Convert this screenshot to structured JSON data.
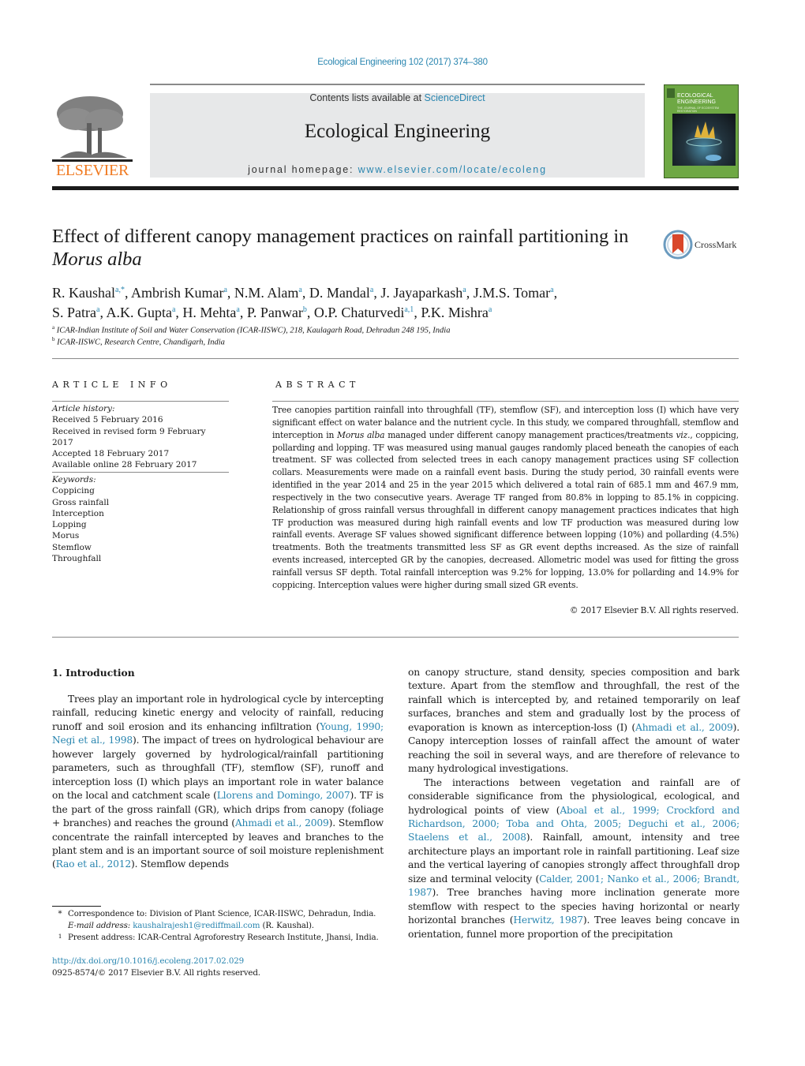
{
  "header": {
    "citation": "Ecological Engineering 102 (2017) 374–380",
    "publisher_logo_text": "ELSEVIER",
    "contents_prefix": "Contents lists available at ",
    "contents_link": "ScienceDirect",
    "journal_title": "Ecological Engineering",
    "homepage_prefix": "journal homepage: ",
    "homepage_link": "www.elsevier.com/locate/ecoleng",
    "cover_title": "ECOLOGICAL ENGINEERING",
    "cover_subtitle": "THE JOURNAL OF ECOSYSTEM RESTORATION"
  },
  "article": {
    "title_main": "Effect of different canopy management practices on rainfall partitioning in ",
    "title_italic": "Morus alba",
    "crossmark_label": "CrossMark",
    "authors": [
      {
        "name": "R. Kaushal",
        "sup": "a,*"
      },
      {
        "name": "Ambrish Kumar",
        "sup": "a"
      },
      {
        "name": "N.M. Alam",
        "sup": "a"
      },
      {
        "name": "D. Mandal",
        "sup": "a"
      },
      {
        "name": "J. Jayaparkash",
        "sup": "a"
      },
      {
        "name": "J.M.S. Tomar",
        "sup": "a"
      },
      {
        "name": "S. Patra",
        "sup": "a"
      },
      {
        "name": "A.K. Gupta",
        "sup": "a"
      },
      {
        "name": "H. Mehta",
        "sup": "a"
      },
      {
        "name": "P. Panwar",
        "sup": "b"
      },
      {
        "name": "O.P. Chaturvedi",
        "sup": "a,1"
      },
      {
        "name": "P.K. Mishra",
        "sup": "a"
      }
    ],
    "affiliations": [
      {
        "mark": "a",
        "text": "ICAR-Indian Institute of Soil and Water Conservation (ICAR-IISWC), 218, Kaulagarh Road, Dehradun 248 195, India"
      },
      {
        "mark": "b",
        "text": "ICAR-IISWC, Research Centre, Chandigarh, India"
      }
    ]
  },
  "article_info": {
    "heading": "ARTICLE INFO",
    "history_label": "Article history:",
    "history": [
      "Received 5 February 2016",
      "Received in revised form 9 February 2017",
      "Accepted 18 February 2017",
      "Available online 28 February 2017"
    ],
    "keywords_label": "Keywords:",
    "keywords": [
      "Coppicing",
      "Gross rainfall",
      "Interception",
      "Lopping",
      "Morus",
      "Stemflow",
      "Throughfall"
    ]
  },
  "abstract": {
    "heading": "ABSTRACT",
    "p1": "Tree canopies partition rainfall into throughfall (TF), stemflow (SF), and interception loss (I) which have very significant effect on water balance and the nutrient cycle. In this study, we compared throughfall, stemflow and interception in ",
    "italic1": "Morus alba",
    "p2": " managed under different canopy management practices/treatments ",
    "italic2": "viz.",
    "p3": ", coppicing, pollarding and lopping. TF was measured using manual gauges randomly placed beneath the canopies of each treatment. SF was collected from selected trees in each canopy management practices using SF collection collars. Measurements were made on a rainfall event basis. During the study period, 30 rainfall events were identified in the year 2014 and 25 in the year 2015 which delivered a total rain of 685.1 mm and 467.9 mm, respectively in the two consecutive years. Average TF ranged from 80.8% in lopping to 85.1% in coppicing. Relationship of gross rainfall versus throughfall in different canopy management practices indicates that high TF production was measured during high rainfall events and low TF production was measured during low rainfall events. Average SF values showed significant difference between lopping (10%) and pollarding (4.5%) treatments. Both the treatments transmitted less SF as GR event depths increased. As the size of rainfall events increased, intercepted GR by the canopies, decreased. Allometric model was used for fitting the gross rainfall versus SF depth. Total rainfall interception was 9.2% for lopping, 13.0% for pollarding and 14.9% for coppicing. Interception values were higher during small sized GR events.",
    "copyright": "© 2017 Elsevier B.V. All rights reserved."
  },
  "introduction": {
    "heading": "1.  Introduction",
    "left_p1_a": "Trees play an important role in hydrological cycle by intercepting rainfall, reducing kinetic energy and velocity of rainfall, reducing runoff and soil erosion and its enhancing infiltration (",
    "left_p1_ref1": "Young, 1990; Negi et al., 1998",
    "left_p1_b": "). The impact of trees on hydrological behaviour are however largely governed by hydrological/rainfall partitioning parameters, such as throughfall (TF), stemflow (SF), runoff and interception loss (I) which plays an important role in water balance on the local and catchment scale (",
    "left_p1_ref2": "Llorens and Domingo, 2007",
    "left_p1_c": "). TF is the part of the gross rainfall (GR), which drips from canopy (foliage + branches) and reaches the ground (",
    "left_p1_ref3": "Ahmadi et al., 2009",
    "left_p1_d": "). Stemflow concentrate the rainfall intercepted by leaves and branches to the plant stem and is an important source of soil moisture replenishment (",
    "left_p1_ref4": "Rao et al., 2012",
    "left_p1_e": "). Stemflow depends",
    "right_p1_a": "on canopy structure, stand density, species composition and bark texture. Apart from the stemflow and throughfall, the rest of the rainfall which is intercepted by, and retained temporarily on leaf surfaces, branches and stem and gradually lost by the process of evaporation is known as interception-loss (I) (",
    "right_p1_ref1": "Ahmadi et al., 2009",
    "right_p1_b": "). Canopy interception losses of rainfall affect the amount of water reaching the soil in several ways, and are therefore of relevance to many hydrological investigations.",
    "right_p2_a": "The interactions between vegetation and rainfall are of considerable significance from the physiological, ecological, and hydrological points of view (",
    "right_p2_ref1": "Aboal et al., 1999; Crockford and Richardson, 2000; Toba and Ohta, 2005; Deguchi et al., 2006; Staelens et al., 2008",
    "right_p2_b": "). Rainfall, amount, intensity and tree architecture plays an important role in rainfall partitioning. Leaf size and the vertical layering of canopies strongly affect throughfall drop size and terminal velocity (",
    "right_p2_ref2": "Calder, 2001; Nanko et al., 2006; Brandt, 1987",
    "right_p2_c": "). Tree branches having more inclination generate more stemflow with respect to the species having horizontal or nearly horizontal branches (",
    "right_p2_ref3": "Herwitz, 1987",
    "right_p2_d": "). Tree leaves being concave in orientation, funnel more proportion of the precipitation"
  },
  "footnotes": {
    "corr_mark": "*",
    "corr_text": "Correspondence to: Division of Plant Science, ICAR-IISWC, Dehradun, India.",
    "email_label": "E-mail address: ",
    "email": "kaushalrajesh1@rediffmail.com",
    "email_suffix": " (R. Kaushal).",
    "present_mark": "1",
    "present_text": "Present address: ICAR-Central Agroforestry Research Institute, Jhansi, India.",
    "doi": "http://dx.doi.org/10.1016/j.ecoleng.2017.02.029",
    "issn": "0925-8574/© 2017 Elsevier B.V. All rights reserved."
  },
  "colors": {
    "link": "#2a86b0",
    "elsevier_orange": "#f07a21",
    "banner_gray": "#e7e8e9"
  }
}
